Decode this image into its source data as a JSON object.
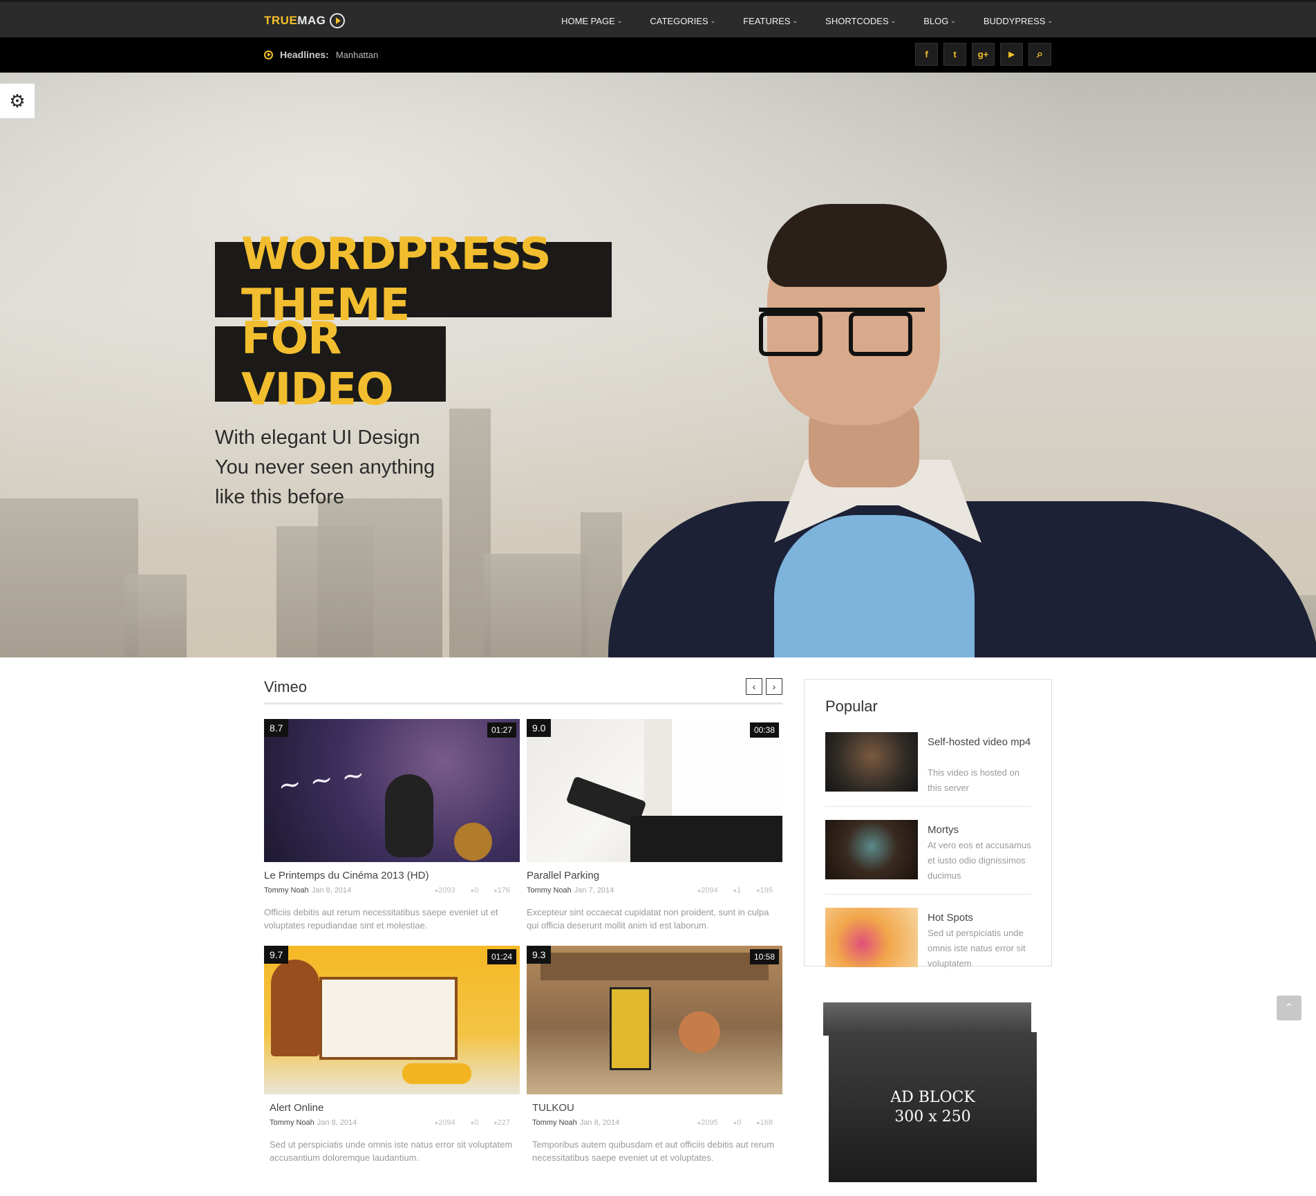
{
  "logo": {
    "part1": "TRUE",
    "part2": "MAG"
  },
  "nav": [
    {
      "label": "HOME PAGE"
    },
    {
      "label": "CATEGORIES"
    },
    {
      "label": "FEATURES"
    },
    {
      "label": "SHORTCODES"
    },
    {
      "label": "BLOG"
    },
    {
      "label": "BUDDYPRESS"
    }
  ],
  "headlines": {
    "label": "Headlines:",
    "value": "Manhattan"
  },
  "social_icons": [
    "facebook-icon",
    "twitter-icon",
    "google-plus-icon",
    "youtube-icon",
    "search-icon"
  ],
  "social_glyphs": [
    "f",
    "t",
    "g+",
    "▶",
    "⌕"
  ],
  "hero": {
    "title_line1": "WORDPRESS THEME",
    "title_line2": "FOR VIDEO",
    "sub_line1": "With elegant UI Design",
    "sub_line2": "You never seen anything",
    "sub_line3": "like this before"
  },
  "section": {
    "title": "Vimeo",
    "prev": "‹",
    "next": "›"
  },
  "cards": [
    {
      "score": "8.7",
      "duration": "01:27",
      "title": "Le Printemps du Cinéma 2013 (HD)",
      "author": "Tommy Noah",
      "date": "Jan 8, 2014",
      "views": "2093",
      "comments": "0",
      "likes": "176",
      "desc": "Officiis debitis aut rerum necessitatibus saepe eveniet ut et voluptates repudiandae sint et molestiae."
    },
    {
      "score": "9.0",
      "duration": "00:38",
      "title": "Parallel Parking",
      "author": "Tommy Noah",
      "date": "Jan 7, 2014",
      "views": "2094",
      "comments": "1",
      "likes": "195",
      "desc": "Excepteur sint occaecat cupidatat non proident, sunt in culpa qui officia deserunt mollit anim id est laborum."
    },
    {
      "score": "9.7",
      "duration": "01:24",
      "title": "Alert Online",
      "author": "Tommy Noah",
      "date": "Jan 8, 2014",
      "views": "2094",
      "comments": "0",
      "likes": "227",
      "desc": "Sed ut perspiciatis unde omnis iste natus error sit voluptatem accusantium doloremque laudantium."
    },
    {
      "score": "9.3",
      "duration": "10:58",
      "title": "TULKOU",
      "author": "Tommy Noah",
      "date": "Jan 8, 2014",
      "views": "2095",
      "comments": "0",
      "likes": "168",
      "desc": "Temporibus autem quibusdam et aut officiis debitis aut rerum necessitatibus saepe eveniet ut et voluptates."
    }
  ],
  "popular": {
    "title": "Popular",
    "items": [
      {
        "title": "Self-hosted video mp4",
        "desc": "This video is hosted on this server"
      },
      {
        "title": "Mortys",
        "desc": "At vero eos et accusamus et iusto odio dignissimos ducimus"
      },
      {
        "title": "Hot Spots",
        "desc": "Sed ut perspiciatis unde omnis iste natus error sit voluptatem"
      }
    ]
  },
  "ad": {
    "line1": "AD BLOCK",
    "line2": "300 x 250"
  },
  "colors": {
    "accent": "#f5c02a",
    "topbar": "#2b2b2b",
    "headbar": "#000000"
  }
}
